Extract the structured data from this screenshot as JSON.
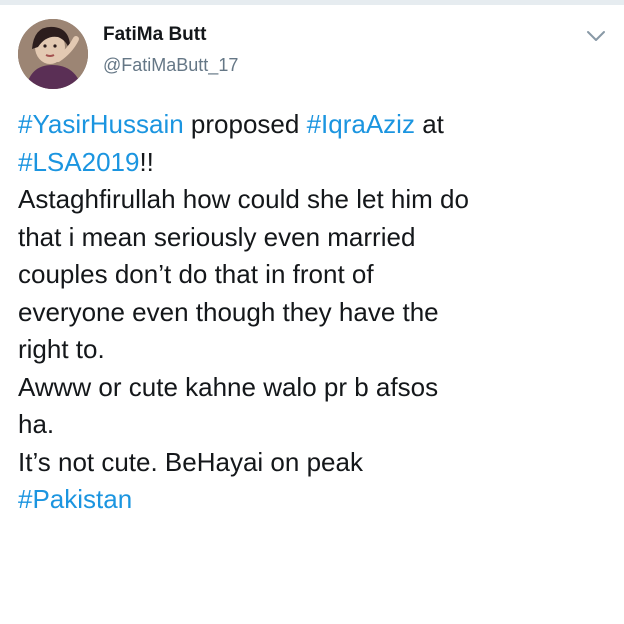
{
  "author": {
    "display_name": "FatiMa Butt",
    "handle": "@FatiMaButt_17"
  },
  "icons": {
    "menu": "chevron-down-icon",
    "avatar": "profile-photo"
  },
  "colors": {
    "hashtag": "#1b95e0",
    "text": "#14171a",
    "secondary": "#657786",
    "divider": "#e6ecf0"
  },
  "tweet": {
    "hashtag_yasir": "#YasirHussain",
    "text_proposed": " proposed ",
    "hashtag_iqra": "#IqraAziz",
    "text_at": " at",
    "hashtag_lsa": "#LSA2019",
    "text_excl": "!!",
    "line_3": "Astaghfirullah how could she let him do",
    "line_4": "that i mean seriously even married",
    "line_5": "couples don’t do that in front of",
    "line_6": "everyone even though they have the",
    "line_7": "right to.",
    "line_8": "Awww or cute kahne walo pr b afsos",
    "line_9": "ha.",
    "line_10": "It’s not cute. BeHayai on peak",
    "hashtag_pakistan": "#Pakistan"
  }
}
